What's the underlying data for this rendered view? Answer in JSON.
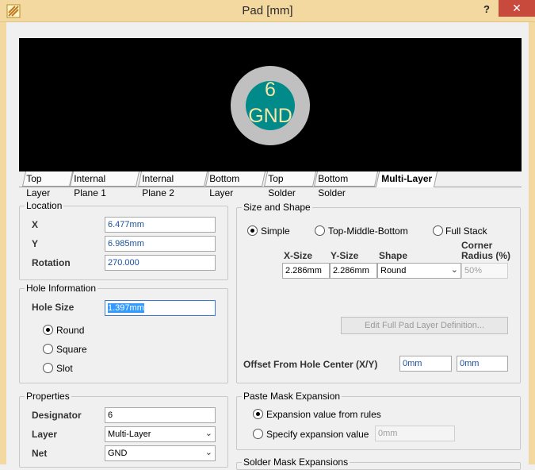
{
  "window": {
    "title": "Pad [mm]",
    "help": "?",
    "close": "✕"
  },
  "preview": {
    "pad_number": "6",
    "pad_net": "GND"
  },
  "tabs": [
    "Top Layer",
    "Internal Plane 1",
    "Internal Plane 2",
    "Bottom Layer",
    "Top Solder",
    "Bottom Solder",
    "Multi-Layer"
  ],
  "active_tab": "Multi-Layer",
  "location": {
    "title": "Location",
    "x_label": "X",
    "x_value": "6.477mm",
    "y_label": "Y",
    "y_value": "6.985mm",
    "rotation_label": "Rotation",
    "rotation_value": "270.000"
  },
  "hole": {
    "title": "Hole Information",
    "size_label": "Hole Size",
    "size_value": "1.397mm",
    "round": "Round",
    "square": "Square",
    "slot": "Slot",
    "selected": "Round"
  },
  "properties": {
    "title": "Properties",
    "designator_label": "Designator",
    "designator_value": "6",
    "layer_label": "Layer",
    "layer_value": "Multi-Layer",
    "net_label": "Net",
    "net_value": "GND"
  },
  "size_shape": {
    "title": "Size and Shape",
    "simple": "Simple",
    "top_middle_bottom": "Top-Middle-Bottom",
    "full_stack": "Full Stack",
    "selected": "Simple",
    "headers": {
      "x_size": "X-Size",
      "y_size": "Y-Size",
      "shape": "Shape",
      "corner_1": "Corner",
      "corner_2": "Radius (%)"
    },
    "row": {
      "x_size": "2.286mm",
      "y_size": "2.286mm",
      "shape": "Round",
      "corner": "50%"
    },
    "edit_button": "Edit Full Pad Layer Definition...",
    "offset_label": "Offset From Hole Center (X/Y)",
    "offset_x": "0mm",
    "offset_y": "0mm"
  },
  "paste_mask": {
    "title": "Paste Mask Expansion",
    "from_rules": "Expansion value from rules",
    "specify": "Specify expansion value",
    "specify_value": "0mm",
    "selected": "from_rules"
  },
  "solder_mask": {
    "title": "Solder Mask Expansions"
  },
  "colors": {
    "titlebar": "#f3d9a0",
    "close": "#c74a3c",
    "pad_ring": "#c0c0c0",
    "pad_hole": "#008a8a",
    "pad_text": "#f5e6a8",
    "value_text": "#1b4f9a"
  }
}
